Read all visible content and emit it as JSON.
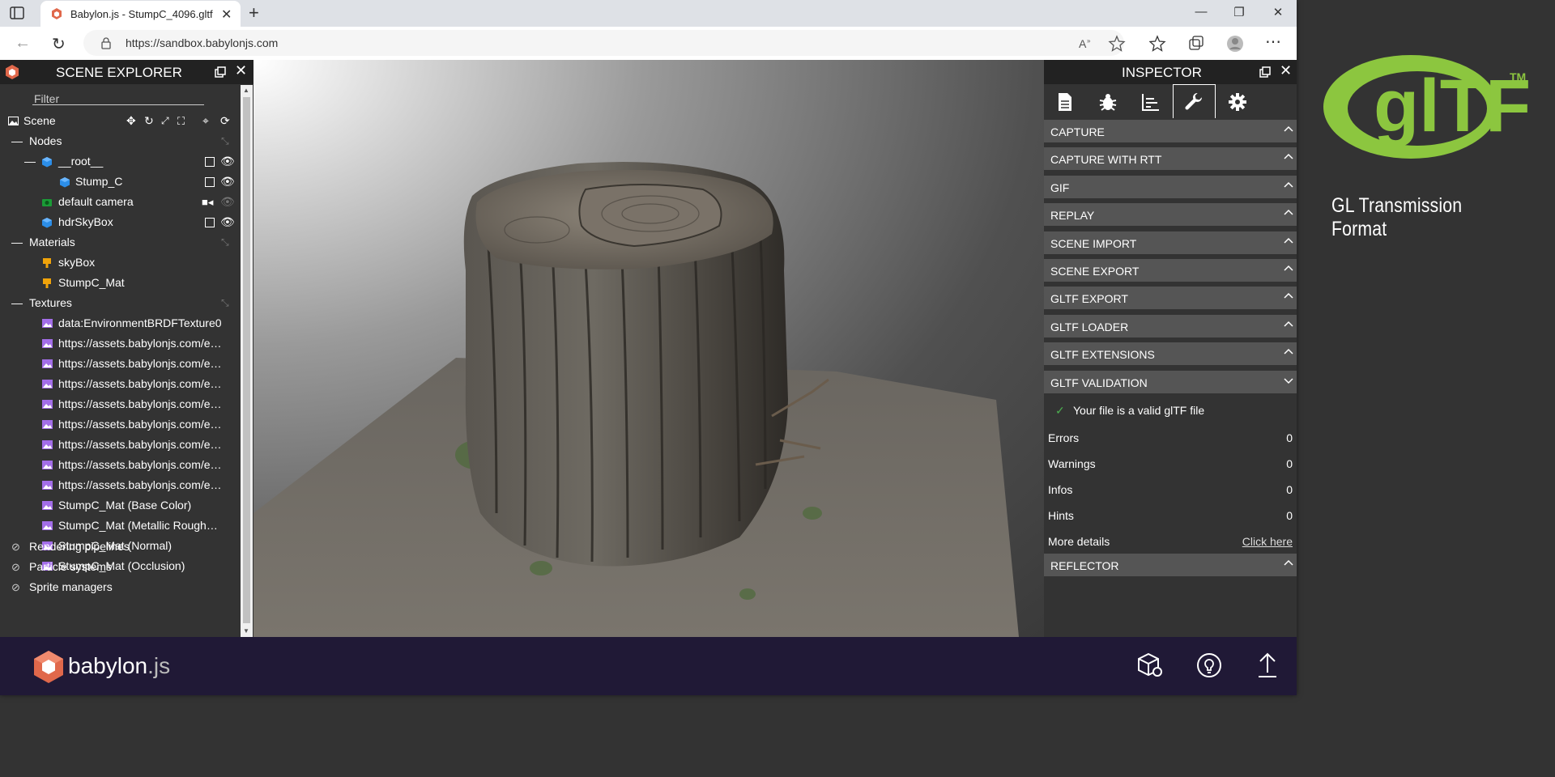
{
  "browser": {
    "tab_title": "Babylon.js - StumpC_4096.gltf",
    "url": "https://sandbox.babylonjs.com"
  },
  "explorer": {
    "title": "SCENE EXPLORER",
    "filter_placeholder": "Filter",
    "scene_label": "Scene",
    "nodes_label": "Nodes",
    "root_label": "__root__",
    "stump_label": "Stump_C",
    "camera_label": "default camera",
    "skybox_label": "hdrSkyBox",
    "materials_label": "Materials",
    "materials": [
      "skyBox",
      "StumpC_Mat"
    ],
    "textures_label": "Textures",
    "textures": [
      "data:EnvironmentBRDFTexture0",
      "https://assets.babylonjs.com/e…",
      "https://assets.babylonjs.com/e…",
      "https://assets.babylonjs.com/e…",
      "https://assets.babylonjs.com/e…",
      "https://assets.babylonjs.com/e…",
      "https://assets.babylonjs.com/e…",
      "https://assets.babylonjs.com/e…",
      "https://assets.babylonjs.com/e…",
      "StumpC_Mat (Base Color)",
      "StumpC_Mat (Metallic Rough…",
      "StumpC_Mat (Normal)",
      "StumpC_Mat (Occlusion)"
    ],
    "rendering_pipelines": "Rendering pipelines",
    "particle_systems": "Particle systems",
    "sprite_managers": "Sprite managers"
  },
  "inspector": {
    "title": "INSPECTOR",
    "sections": [
      "CAPTURE",
      "CAPTURE WITH RTT",
      "GIF",
      "REPLAY",
      "SCENE IMPORT",
      "SCENE EXPORT",
      "GLTF EXPORT",
      "GLTF LOADER",
      "GLTF EXTENSIONS",
      "GLTF VALIDATION"
    ],
    "valid_message": "Your file is a valid glTF file",
    "props": [
      {
        "key": "Errors",
        "value": "0"
      },
      {
        "key": "Warnings",
        "value": "0"
      },
      {
        "key": "Infos",
        "value": "0"
      },
      {
        "key": "Hints",
        "value": "0"
      }
    ],
    "more_details_label": "More details",
    "more_details_link": "Click here",
    "reflector": "REFLECTOR"
  },
  "footer": {
    "brand": "babylon",
    "brand_suffix": ".js"
  },
  "overlay": {
    "gltf_text": "glTF",
    "gltf_tm": "TM",
    "subtitle": "GL Transmission Format"
  },
  "colors": {
    "explorer_bg": "#333333",
    "footer_bg": "#201936",
    "gltf_green": "#8cc63f",
    "section_bg": "#555555"
  }
}
